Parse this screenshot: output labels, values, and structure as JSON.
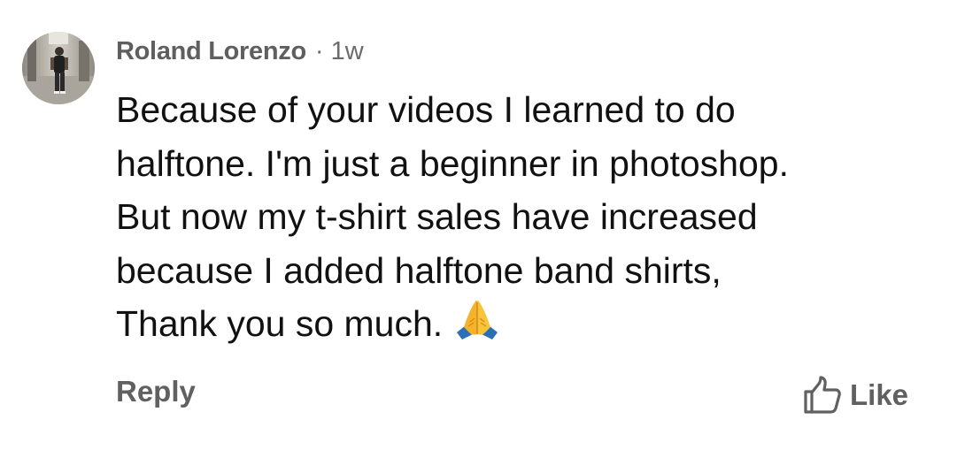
{
  "comment": {
    "author": "Roland Lorenzo",
    "separator": "·",
    "timestamp": "1w",
    "body_lines": [
      "Because of your videos I learned to do",
      "halftone. I'm just a beginner in photoshop.",
      "But now my t-shirt sales have increased",
      "because I added halftone band shirts,",
      "Thank you so much."
    ],
    "emoji": "folded-hands-icon",
    "avatar": "avatar"
  },
  "actions": {
    "reply_label": "Reply",
    "like_label": "Like",
    "like_icon": "thumbs-up-icon"
  },
  "colors": {
    "text_primary": "#111111",
    "text_secondary": "#606060",
    "background": "#ffffff"
  }
}
